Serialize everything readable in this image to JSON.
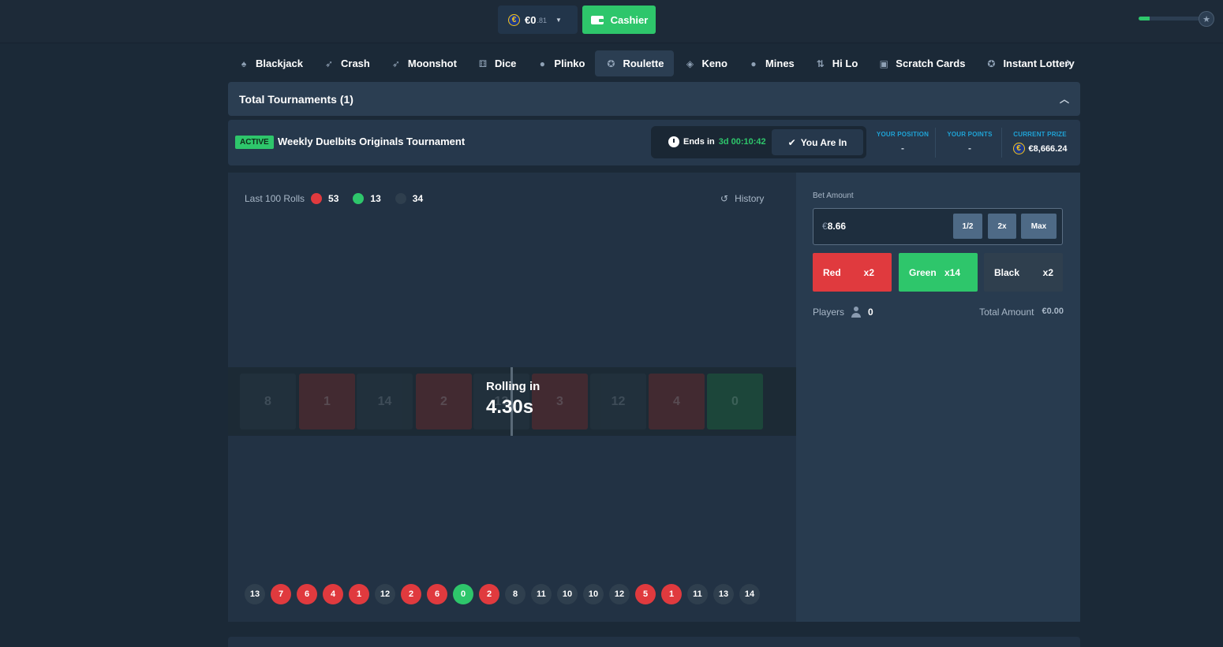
{
  "topbar": {
    "balance_main": "€0",
    "balance_sub": ".81",
    "currency_symbol": "€",
    "cashier_label": "Cashier",
    "xp_progress": 0.18
  },
  "games_nav": {
    "items": [
      {
        "label": "Blackjack",
        "icon": "blackjack-icon",
        "glyph": "♠"
      },
      {
        "label": "Crash",
        "icon": "rocket-icon",
        "glyph": "➶"
      },
      {
        "label": "Moonshot",
        "icon": "moonshot-icon",
        "glyph": "➶"
      },
      {
        "label": "Dice",
        "icon": "dice-icon",
        "glyph": "⚅"
      },
      {
        "label": "Plinko",
        "icon": "plinko-icon",
        "glyph": "●"
      },
      {
        "label": "Roulette",
        "icon": "roulette-icon",
        "glyph": "✪",
        "active": true
      },
      {
        "label": "Keno",
        "icon": "keno-icon",
        "glyph": "◈"
      },
      {
        "label": "Mines",
        "icon": "mine-icon",
        "glyph": "●"
      },
      {
        "label": "Hi Lo",
        "icon": "hilo-icon",
        "glyph": "⇅"
      },
      {
        "label": "Scratch Cards",
        "icon": "scratch-card-icon",
        "glyph": "▣"
      },
      {
        "label": "Instant Lottery",
        "icon": "lottery-icon",
        "glyph": "✪"
      }
    ]
  },
  "tournaments": {
    "header": "Total Tournaments (1)",
    "status": "ACTIVE",
    "title": "Weekly Duelbits Originals Tournament",
    "ends_label": "Ends in",
    "ends_value": "3d 00:10:42",
    "you_are_in": "You Are In",
    "position_label": "YOUR POSITION",
    "position_value": "-",
    "points_label": "YOUR POINTS",
    "points_value": "-",
    "prize_label": "CURRENT PRIZE",
    "prize_value": "€8,666.24"
  },
  "roulette": {
    "last_rolls_label": "Last 100 Rolls",
    "red_count": "53",
    "green_count": "13",
    "black_count": "34",
    "history_label": "History",
    "rolling_label": "Rolling in",
    "rolling_time": "4.30s",
    "reel": [
      {
        "n": "8",
        "c": "black"
      },
      {
        "n": "1",
        "c": "red"
      },
      {
        "n": "14",
        "c": "black"
      },
      {
        "n": "2",
        "c": "red"
      },
      {
        "n": "13",
        "c": "black"
      },
      {
        "n": "3",
        "c": "red"
      },
      {
        "n": "12",
        "c": "black"
      },
      {
        "n": "4",
        "c": "red"
      },
      {
        "n": "0",
        "c": "green"
      }
    ],
    "past_rolls": [
      {
        "n": "13",
        "c": "black"
      },
      {
        "n": "7",
        "c": "red"
      },
      {
        "n": "6",
        "c": "red"
      },
      {
        "n": "4",
        "c": "red"
      },
      {
        "n": "1",
        "c": "red"
      },
      {
        "n": "12",
        "c": "black"
      },
      {
        "n": "2",
        "c": "red"
      },
      {
        "n": "6",
        "c": "red"
      },
      {
        "n": "0",
        "c": "green"
      },
      {
        "n": "2",
        "c": "red"
      },
      {
        "n": "8",
        "c": "black"
      },
      {
        "n": "11",
        "c": "black"
      },
      {
        "n": "10",
        "c": "black"
      },
      {
        "n": "10",
        "c": "black"
      },
      {
        "n": "12",
        "c": "black"
      },
      {
        "n": "5",
        "c": "red"
      },
      {
        "n": "1",
        "c": "red"
      },
      {
        "n": "11",
        "c": "black"
      },
      {
        "n": "13",
        "c": "black"
      },
      {
        "n": "14",
        "c": "black"
      }
    ]
  },
  "bet": {
    "label": "Bet Amount",
    "currency": "€",
    "amount": "8.66",
    "half_label": "1/2",
    "double_label": "2x",
    "max_label": "Max",
    "red_label": "Red",
    "red_mult": "x2",
    "green_label": "Green",
    "green_mult": "x14",
    "black_label": "Black",
    "black_mult": "x2",
    "players_label": "Players",
    "players_count": "0",
    "total_label": "Total Amount",
    "total_value": "€0.00"
  },
  "colors": {
    "red": "#e03a3e",
    "green": "#2ec66b",
    "black": "#2f3f4e",
    "background": "#1b2937"
  }
}
